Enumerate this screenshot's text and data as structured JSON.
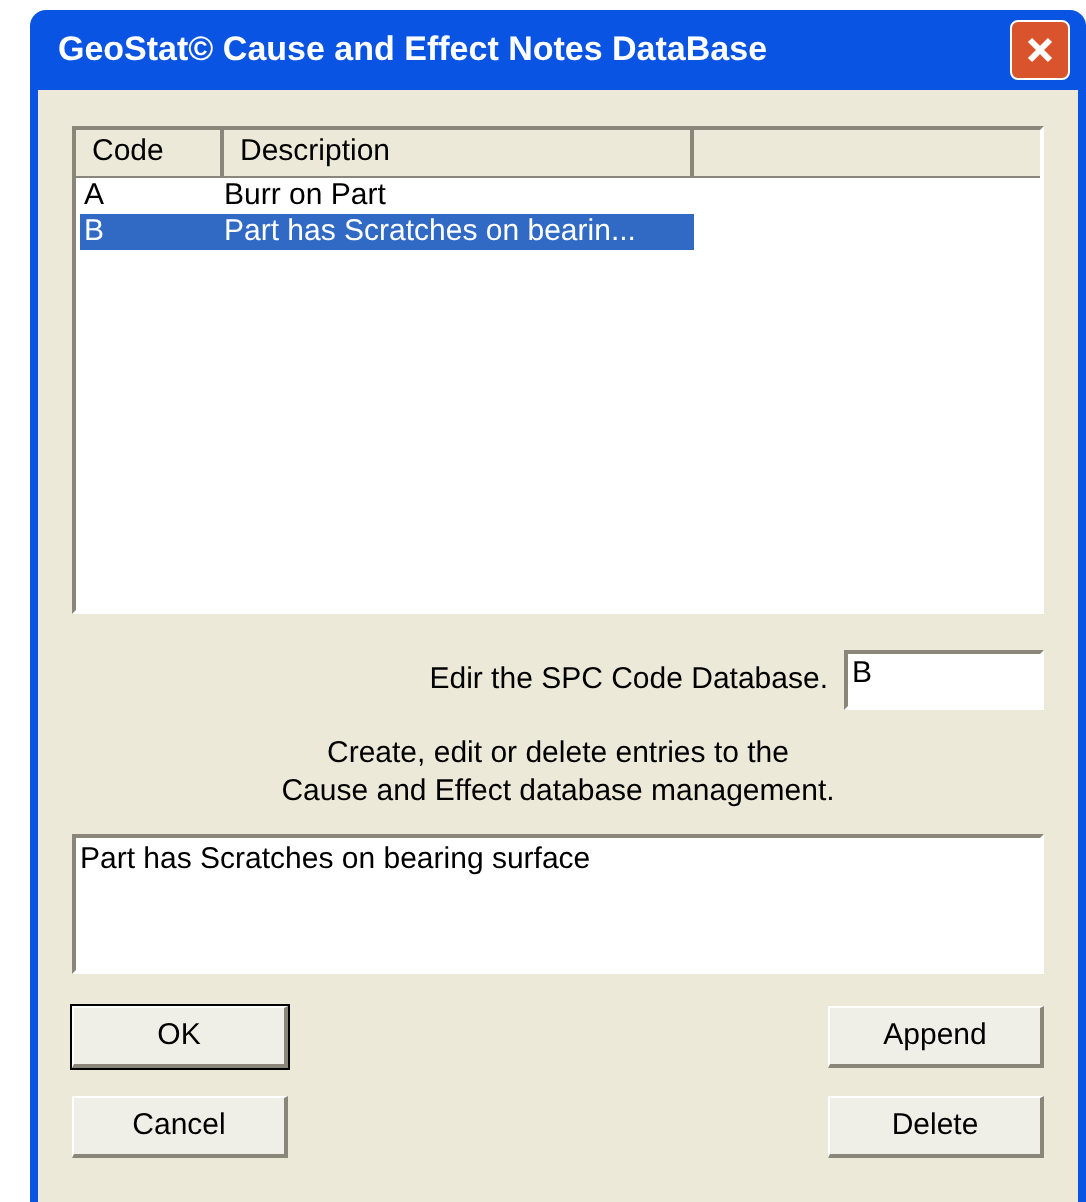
{
  "window": {
    "title": "GeoStat© Cause and Effect Notes DataBase"
  },
  "list": {
    "columns": [
      "Code",
      "Description"
    ],
    "rows": [
      {
        "code": "A",
        "description": "Burr on Part",
        "selected": false
      },
      {
        "code": "B",
        "description": "Part has Scratches on bearin...",
        "selected": true
      }
    ]
  },
  "code_field": {
    "label": "Edir the SPC Code Database.",
    "value": "B"
  },
  "info": [
    "Create, edit or delete entries to the",
    "Cause and Effect database management."
  ],
  "note_field": {
    "value": "Part has Scratches on bearing surface"
  },
  "buttons": [
    {
      "label": "OK",
      "default": true
    },
    {
      "label": "Append",
      "default": false
    },
    {
      "label": "Cancel",
      "default": false
    },
    {
      "label": "Delete",
      "default": false
    }
  ]
}
